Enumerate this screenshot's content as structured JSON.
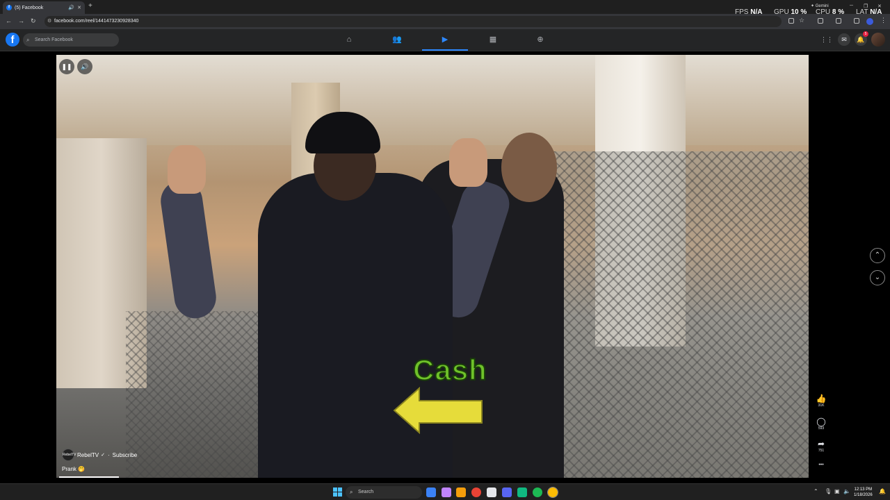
{
  "browser": {
    "tab_title": "(5) Facebook",
    "url": "facebook.com/reel/1441473230928340",
    "new_tab_symbol": "+",
    "gemini_label": "Gemini"
  },
  "perf_overlay": {
    "fps_label": "FPS",
    "fps_value": "N/A",
    "gpu_label": "GPU",
    "gpu_value": "10 %",
    "cpu_label": "CPU",
    "cpu_value": "8 %",
    "lat_label": "LAT",
    "lat_value": "N/A"
  },
  "facebook": {
    "search_placeholder": "Search Facebook",
    "notification_count": "5",
    "nav_items": [
      "home-icon",
      "friends-icon",
      "video-icon",
      "marketplace-icon",
      "gaming-icon"
    ],
    "active_nav": "video-icon",
    "accent_color": "#2d88ff"
  },
  "reel": {
    "overlay_text": "Cash",
    "channel_name": "RebelTV",
    "channel_avatar_text": "RebelTV",
    "subscribe_label": "Subscribe",
    "separator": "·",
    "caption": "Prank 🤭",
    "likes": "31K",
    "comments": "593",
    "shares": "751",
    "more_symbol": "•••",
    "progress_fraction": 0.08
  },
  "taskbar": {
    "search_placeholder": "Search",
    "time": "12:13 PM",
    "date": "1/18/2026"
  }
}
